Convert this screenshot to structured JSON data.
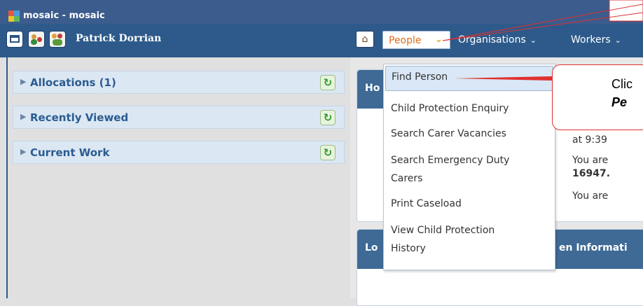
{
  "window": {
    "title": "mosaic - mosaic"
  },
  "topbar": {
    "user_name": "Patrick Dorrian",
    "nav": {
      "people_label": "People",
      "chevron": "⌄",
      "organisations_label": "Organisations",
      "workers_label": "Workers"
    }
  },
  "sidebar": {
    "panels": [
      {
        "label": "Allocations (1)"
      },
      {
        "label": "Recently Viewed"
      },
      {
        "label": "Current Work"
      }
    ]
  },
  "dropdown": {
    "items": [
      "Find Person",
      "Child Protection Enquiry",
      "Search Carer Vacancies",
      "Search Emergency Duty",
      "Carers",
      "Print Caseload",
      "View Child Protection",
      "History"
    ]
  },
  "main": {
    "box1_title_fragment": "Ho",
    "box1_lines": [
      "at 9:39",
      "You are",
      "16947.",
      "You are"
    ],
    "box2_title_fragment": "Lo",
    "box2_title_tail": "en Informati"
  },
  "callout": {
    "line1": "Clic",
    "line2": "Pe"
  },
  "colors": {
    "titlebar": "#3b5c8c",
    "topbar": "#2d5a8a",
    "accent_orange": "#e06a1a",
    "callout_red": "#e03030"
  },
  "icons": {
    "home": "home-icon",
    "refresh": "refresh-icon",
    "window": "window-icon"
  }
}
